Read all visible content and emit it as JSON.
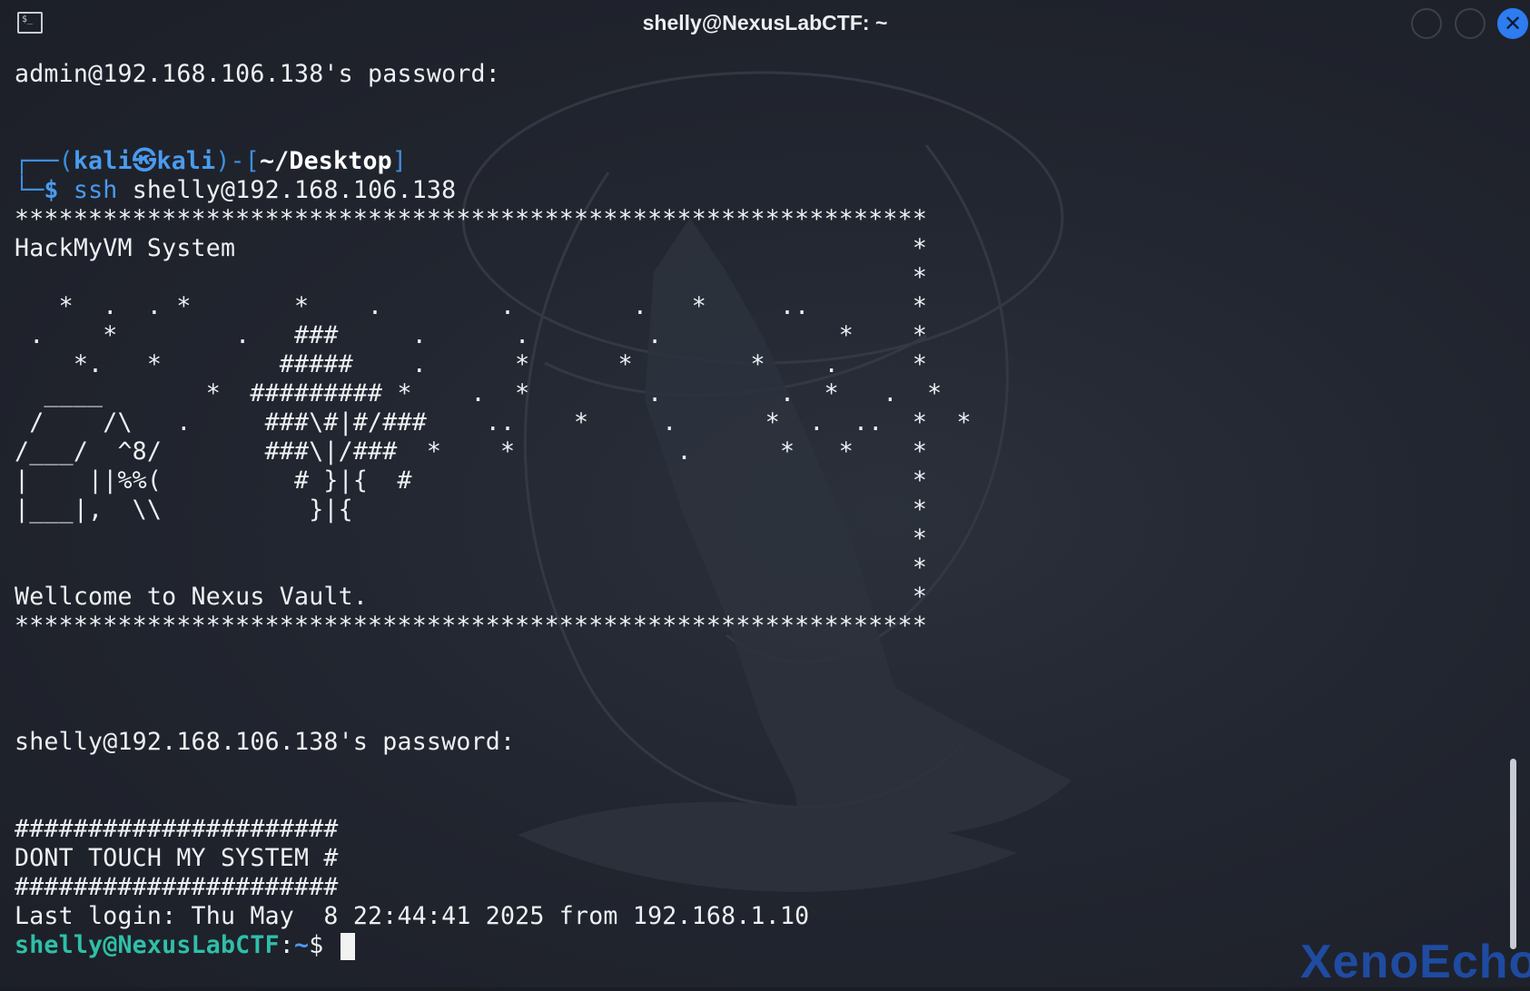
{
  "window": {
    "title": "shelly@NexusLabCTF: ~",
    "icon": "terminal-icon",
    "close_symbol": "✕"
  },
  "terminal": {
    "line_admin_password": "admin@192.168.106.138's password:",
    "prompt": {
      "open": "┌──(",
      "user": "kali",
      "sep": "㉿",
      "host": "kali",
      "mid": ")-[",
      "path": "~/Desktop",
      "close": "]",
      "corner": "└─",
      "dollar": "$",
      "cmd": "ssh",
      "args": " shelly@192.168.106.138"
    },
    "banner_lines": [
      "**************************************************************",
      "HackMyVM System                                              *",
      "                                                             *",
      "   *  .  . *       *    .        .        .   *     ..       *",
      " .    *        .   ###     .      .        .            *    *",
      "    *.   *        #####    .      *      *        *    .     *",
      "  ____       *  ######### *    .  *        .        .  *   .  *",
      " /    /\\   .     ###\\#|#/###    ..    *     .      *  .  ..  *  *",
      "/___/  ^8/       ###\\|/###  *    *           .      *   *    *",
      "|    ||%%(         # }|{  #                                  *",
      "|___|,  \\\\          }|{                                      *",
      "                                                             *",
      "                                                             *",
      "Wellcome to Nexus Vault.                                     *",
      "**************************************************************"
    ],
    "line_shelly_password": "shelly@192.168.106.138's password:",
    "motd_lines": [
      "######################",
      "DONT TOUCH MY SYSTEM #",
      "######################"
    ],
    "last_login": "Last login: Thu May  8 22:44:41 2025 from 192.168.1.10",
    "shell_prompt": {
      "userhost": "shelly@NexusLabCTF",
      "colon": ":",
      "path": "~",
      "dollar": "$ "
    }
  },
  "watermark": "XenoEcho",
  "colors": {
    "background": "#22262f",
    "text": "#eef0f3",
    "prompt_blue": "#4a9bee",
    "prompt_green": "#2fbfa8",
    "close_button": "#2d7cf0"
  }
}
